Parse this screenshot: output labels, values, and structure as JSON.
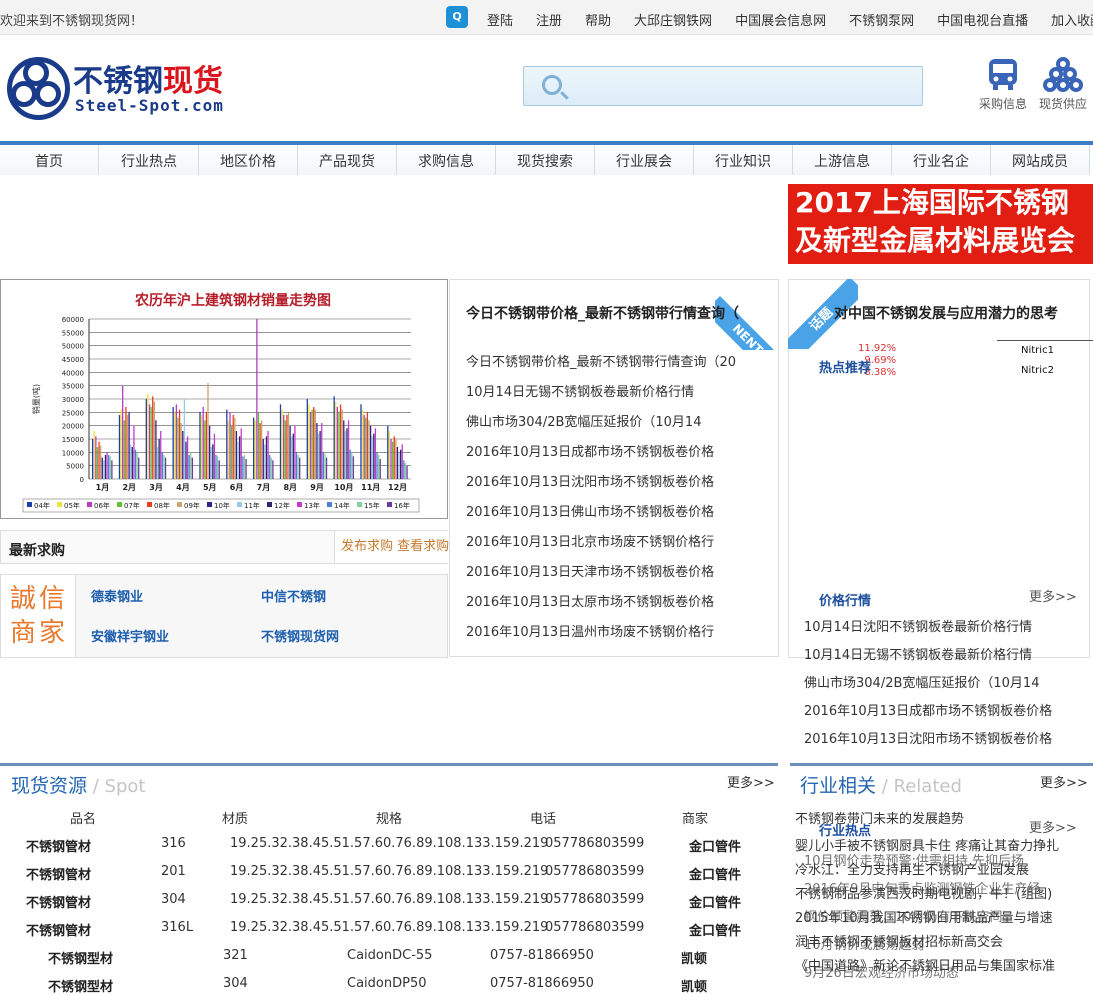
{
  "topbar": {
    "welcome": "欢迎来到不锈钢现货网！",
    "links": [
      "登陆",
      "注册",
      "帮助",
      "大邱庄钢铁网",
      "中国展会信息网",
      "不锈钢泵网",
      "中国电视台直播",
      "加入收藏"
    ]
  },
  "logo": {
    "cn_a": "不锈钢",
    "cn_b": "现货",
    "en": "Steel-Spot.com"
  },
  "header_icons": {
    "purchase": "采购信息",
    "supply": "现货供应"
  },
  "nav": [
    "首页",
    "行业热点",
    "地区价格",
    "产品现货",
    "求购信息",
    "现货搜索",
    "行业展会",
    "行业知识",
    "上游信息",
    "行业名企",
    "网站成员"
  ],
  "banner": {
    "line1": "2017上海国际不锈钢",
    "line2": "及新型金属材料展览会"
  },
  "chart_data": {
    "type": "bar",
    "title": "农历年沪上建筑钢材销量走势图",
    "ylabel": "销量(吨)",
    "ylim": [
      0,
      60000
    ],
    "yticks": [
      "0",
      "5000",
      "10000",
      "15000",
      "20000",
      "25000",
      "30000",
      "35000",
      "40000",
      "45000",
      "50000",
      "55000",
      "60000"
    ],
    "categories": [
      "1月",
      "2月",
      "3月",
      "4月",
      "5月",
      "6月",
      "7月",
      "8月",
      "9月",
      "10月",
      "11月",
      "12月"
    ],
    "series_names": [
      "04年",
      "05年",
      "06年",
      "07年",
      "08年",
      "09年",
      "10年",
      "11年",
      "12年",
      "13年",
      "14年",
      "15年",
      "16年"
    ],
    "series_colors": [
      "#1f3fa8",
      "#f2e33a",
      "#b63cc4",
      "#5fc32f",
      "#e8401f",
      "#c9a46b",
      "#3b1f8f",
      "#9ac8e8",
      "#2a2a6b",
      "#c63ad1",
      "#4f7fd8",
      "#7fd3a0",
      "#6c3a9a"
    ],
    "values": [
      [
        15000,
        18000,
        16000,
        12000,
        14000,
        12500,
        8000,
        7000,
        9000,
        10000,
        9000,
        8500,
        7000
      ],
      [
        24000,
        26000,
        35000,
        22000,
        27000,
        24000,
        25000,
        13000,
        12000,
        20000,
        11000,
        10000,
        8000
      ],
      [
        30000,
        32000,
        28000,
        27000,
        31000,
        29000,
        22000,
        12000,
        15000,
        18000,
        10000,
        9000,
        8000
      ],
      [
        27000,
        25000,
        28000,
        23000,
        26000,
        21000,
        18000,
        30000,
        14000,
        16000,
        9000,
        10000,
        8000
      ],
      [
        25000,
        24000,
        27000,
        22000,
        25000,
        36000,
        20000,
        12000,
        13000,
        17000,
        9000,
        8500,
        7000
      ],
      [
        26000,
        22000,
        25000,
        20000,
        24000,
        23000,
        18000,
        14000,
        16000,
        19000,
        8500,
        9000,
        7500
      ],
      [
        23000,
        22000,
        60000,
        25000,
        21000,
        22000,
        15000,
        13000,
        16000,
        18000,
        9000,
        8000,
        7000
      ],
      [
        28000,
        26000,
        24000,
        22000,
        24000,
        25000,
        20000,
        16000,
        17000,
        20000,
        10000,
        9000,
        8000
      ],
      [
        30000,
        28000,
        25000,
        26000,
        27000,
        26000,
        21000,
        17000,
        18000,
        21000,
        10000,
        9500,
        8000
      ],
      [
        31000,
        29000,
        27000,
        25000,
        28000,
        26000,
        22000,
        18000,
        19000,
        22000,
        11000,
        10000,
        8500
      ],
      [
        28000,
        26000,
        24000,
        23000,
        25000,
        22000,
        20000,
        16000,
        17000,
        19000,
        10000,
        9000,
        7500
      ],
      [
        20000,
        18000,
        15000,
        14000,
        16000,
        15000,
        12000,
        10000,
        11000,
        13000,
        7000,
        6000,
        5000
      ]
    ]
  },
  "mid": {
    "next_ribbon": "NENT",
    "title": "今日不锈钢带价格_最新不锈钢带行情查询（",
    "items": [
      "今日不锈钢带价格_最新不锈钢带行情查询（20",
      "10月14日无锡不锈钢板卷最新价格行情",
      "佛山市场304/2B宽幅压延报价（10月14",
      "2016年10月13日成都市场不锈钢板卷价格",
      "2016年10月13日沈阳市场不锈钢板卷价格",
      "2016年10月13日佛山市场不锈钢板卷价格",
      "2016年10月13日北京市场废不锈钢价格行",
      "2016年10月13日天津市场不锈钢板卷价格",
      "2016年10月13日太原市场不锈钢板卷价格",
      "2016年10月13日温州市场废不锈钢价格行"
    ]
  },
  "right": {
    "ribbon": "话题",
    "title": "对中国不锈钢发展与应用潜力的思考",
    "hot_recommend": "热点推荐",
    "table_rows": [
      "Nitric1",
      "Nitric2"
    ],
    "pcts": [
      "11.92%",
      "9.69%",
      "8.38%"
    ],
    "price_head": "价格行情",
    "price_more": "更多>>",
    "price_items": [
      "10月14日沈阳不锈钢板卷最新价格行情",
      "10月14日无锡不锈钢板卷最新价格行情",
      "佛山市场304/2B宽幅压延报价（10月14",
      "2016年10月13日成都市场不锈钢板卷价格",
      "2016年10月13日沈阳市场不锈钢板卷价格"
    ]
  },
  "latest": {
    "title": "最新求购",
    "links": "发布求购 查看求购"
  },
  "trust": {
    "logo_a": "誠信",
    "logo_b": "商家",
    "merchants": [
      "德泰钢业",
      "中信不锈钢",
      "安徽祥宇钢业",
      "不锈钢现货网"
    ]
  },
  "spot": {
    "title": "现货资源",
    "sub": " / Spot",
    "more": "更多>>",
    "headers": [
      "品名",
      "材质",
      "规格",
      "电话",
      "商家"
    ],
    "rows": [
      [
        "不锈钢管材",
        "316",
        "19.25.32.38.45.51.57.60.76.89.108.133.159.219",
        "057786803599",
        "金口管件"
      ],
      [
        "不锈钢管材",
        "201",
        "19.25.32.38.45.51.57.60.76.89.108.133.159.219",
        "057786803599",
        "金口管件"
      ],
      [
        "不锈钢管材",
        "304",
        "19.25.32.38.45.51.57.60.76.89.108.133.159.219",
        "057786803599",
        "金口管件"
      ],
      [
        "不锈钢管材",
        "316L",
        "19.25.32.38.45.51.57.60.76.89.108.133.159.219",
        "057786803599",
        "金口管件"
      ],
      [
        "不锈钢型材",
        "321",
        "CaidonDC-55",
        "0757-81866950",
        "凯顿"
      ],
      [
        "不锈钢型材",
        "304",
        "CaidonDP50",
        "0757-81866950",
        "凯顿"
      ]
    ]
  },
  "related": {
    "title": "行业相关",
    "sub": " / Related",
    "more": "更多>>",
    "items": [
      "不锈钢卷带门未来的发展趋势",
      "婴儿小手被不锈钢厨具卡住 疼痛让其奋力挣扎",
      "冷水江：全力支持再生不锈钢产业园发展",
      "不锈钢制品参演西汉时期电视剧，牛！(组图)",
      "2015年10月我国不锈钢日用制品产量与增速",
      "润丰不锈钢不锈钢板材招标新高交会",
      "《中国道路》新论不锈钢日用品与集国家标准"
    ],
    "hot_head": "行业热点",
    "hot_more": "更多>>",
    "hot_items": [
      "10月钢价走势预警:供需相持 先抑后扬",
      "2016年9月中旬重点监测钢铁企业生产经",
      "钢价预警震荡，10月仍有下跌空间",
      "10月钢价或震荡趋弱",
      "9月26日宏观经济市场动态"
    ]
  }
}
